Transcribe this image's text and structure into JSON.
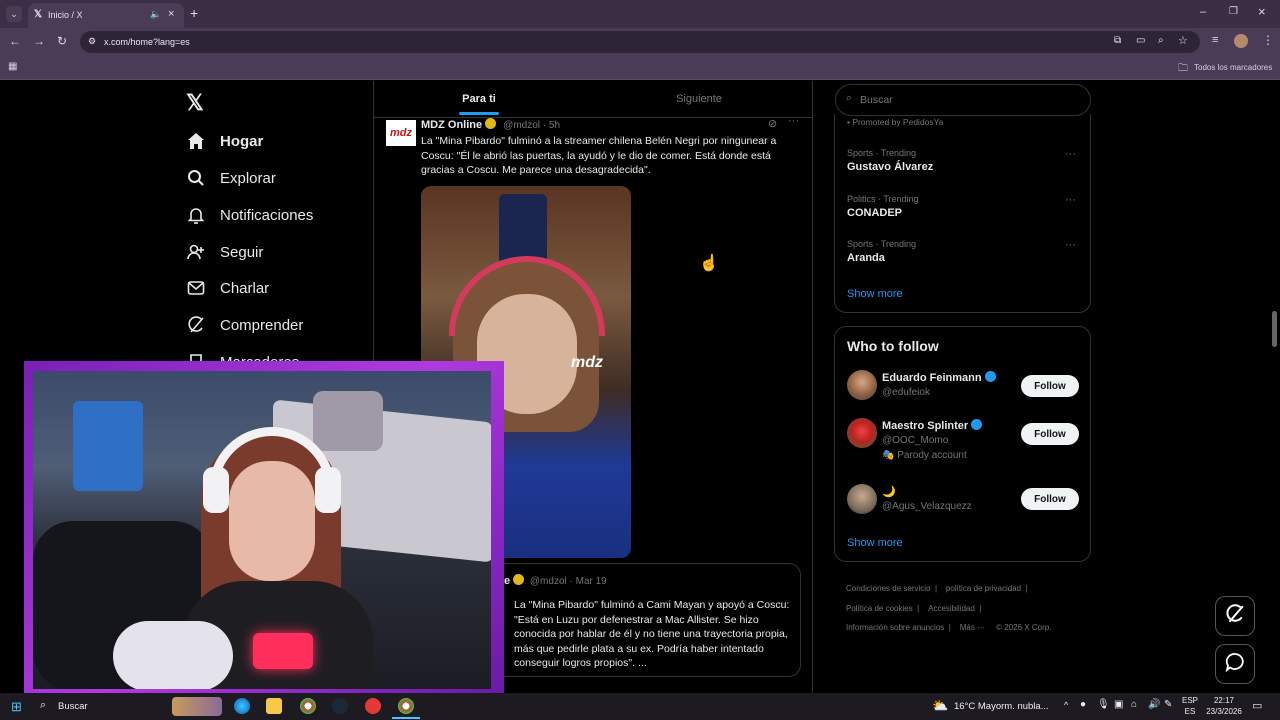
{
  "browser": {
    "tab_title": "Inicio / X",
    "url": "x.com/home?lang=es",
    "bookmarks_label": "Todos los marcadores"
  },
  "nav": {
    "items": [
      {
        "label": "Hogar",
        "icon": "home-icon"
      },
      {
        "label": "Explorar",
        "icon": "search-icon"
      },
      {
        "label": "Notificaciones",
        "icon": "bell-icon"
      },
      {
        "label": "Seguir",
        "icon": "person-plus-icon"
      },
      {
        "label": "Charlar",
        "icon": "mail-icon"
      },
      {
        "label": "Comprender",
        "icon": "grok-icon"
      },
      {
        "label": "Marcadores",
        "icon": "bookmark-icon"
      }
    ]
  },
  "feed": {
    "tabs": [
      "Para ti",
      "Siguiente"
    ],
    "post1": {
      "avatar_text": "mdz",
      "name": "MDZ Online",
      "handle": "@mdzol · 5h",
      "text": "La \"Mina Pibardo\" fulminó a la streamer chilena Belén Negri por ningunear a Coscu: \"Él le abrió las puertas, la ayudó y le dio de comer. Está donde está gracias a Coscu. Me parece una desagradecida\".",
      "image_watermark": "mdz"
    },
    "quote": {
      "name_tail": "e",
      "handle": "@mdzol · Mar 19",
      "text": "La \"Mina Pibardo\" fulminó a Cami Mayan y apoyó a Coscu: \"Está en Luzu por defenestrar a Mac Allister. Se hizo conocida por hablar de él y no tiene una trayectoria propia, más que pedirle plata a su ex. Podría haber intentado conseguir logros propios\".  ..."
    }
  },
  "sidebar": {
    "search_placeholder": "Buscar",
    "promoted": "Promoted by PedidosYa",
    "trends": [
      {
        "category": "Sports · Trending",
        "name": "Gustavo Álvarez"
      },
      {
        "category": "Politics · Trending",
        "name": "CONADEP"
      },
      {
        "category": "Sports · Trending",
        "name": "Aranda"
      }
    ],
    "show_more": "Show more",
    "who_to_follow_title": "Who to follow",
    "follow_label": "Follow",
    "suggestions": [
      {
        "name": "Eduardo Feinmann",
        "handle": "@edufeiok",
        "note": ""
      },
      {
        "name": "Maestro Splinter",
        "handle": "@OOC_Momo",
        "note": "🎭 Parody account"
      },
      {
        "name": "🌙",
        "handle": "@Agus_Velazquezz",
        "note": ""
      }
    ],
    "footer": [
      "Condiciones de servicio",
      "política de privacidad",
      "Política de cookies",
      "Accesibilidad",
      "Información sobre anuncios",
      "Más ···",
      "© 2026 X Corp."
    ]
  },
  "taskbar": {
    "search_label": "Buscar",
    "weather": "16°C  Mayorm. nubla...",
    "lang_top": "ESP",
    "lang_bottom": "ES",
    "time": "22:17",
    "date": "23/3/2026"
  },
  "colors": {
    "accent": "#1d9bf0",
    "overlay_frame": "#9b2bd8",
    "chrome": "#4a3c57"
  }
}
